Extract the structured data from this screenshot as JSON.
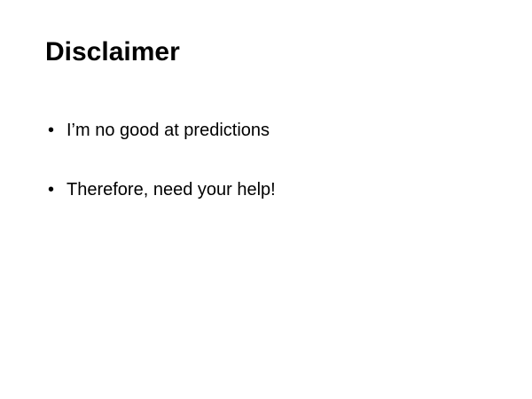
{
  "slide": {
    "title": "Disclaimer",
    "bullet_symbol": "•",
    "bullets": [
      "I’m no good at predictions",
      "Therefore, need your help!"
    ]
  }
}
